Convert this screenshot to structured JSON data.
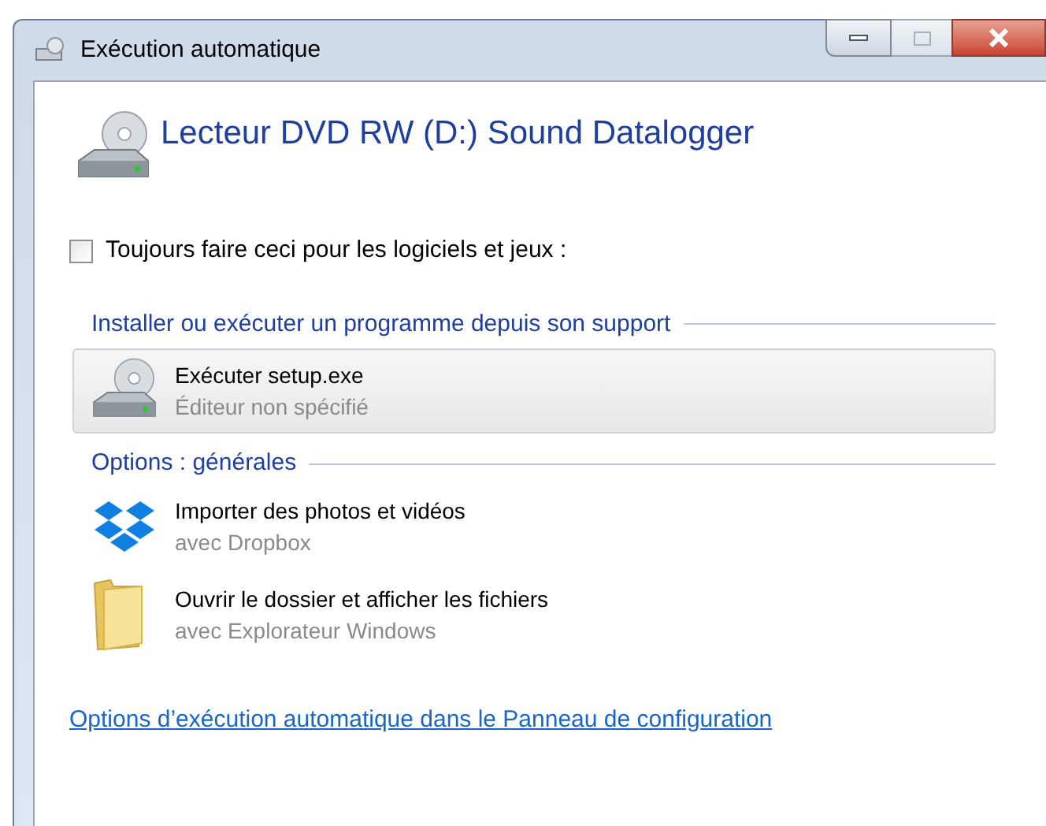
{
  "window": {
    "title": "Exécution automatique"
  },
  "device": {
    "title": "Lecteur DVD RW (D:) Sound Datalogger"
  },
  "always": {
    "label": "Toujours faire ceci pour les logiciels et jeux :",
    "checked": false
  },
  "sections": [
    {
      "heading": "Installer ou exécuter un programme depuis son support",
      "items": [
        {
          "kind": "disc",
          "title": "Exécuter setup.exe",
          "subtitle": "Éditeur non spécifié",
          "selected": true
        }
      ]
    },
    {
      "heading": "Options : générales",
      "items": [
        {
          "kind": "dropbox",
          "title": "Importer des photos et vidéos",
          "subtitle": "avec Dropbox",
          "selected": false
        },
        {
          "kind": "folder",
          "title": "Ouvrir le dossier et afficher les fichiers",
          "subtitle": "avec Explorateur Windows",
          "selected": false
        }
      ]
    }
  ],
  "link": "Options d’exécution automatique dans le Panneau de configuration"
}
